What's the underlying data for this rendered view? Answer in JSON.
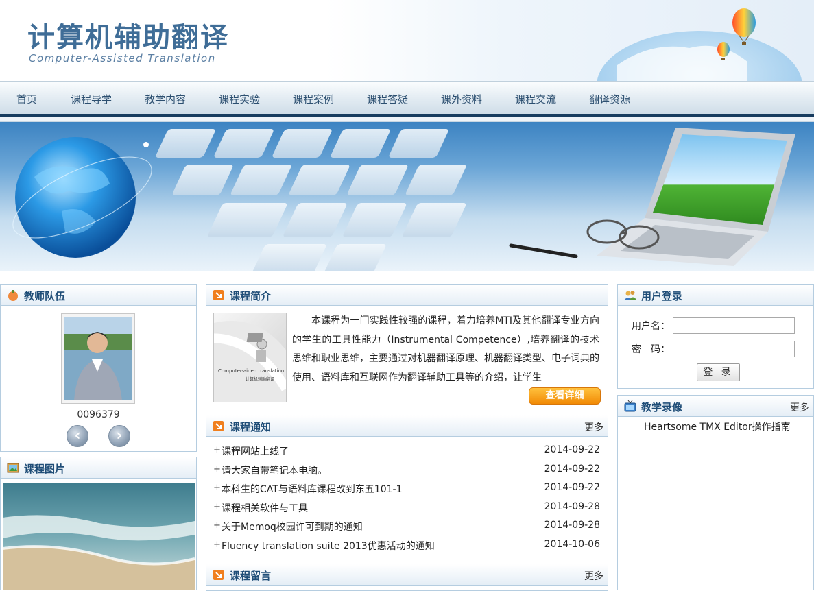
{
  "header": {
    "title": "计算机辅助翻译",
    "subtitle": "Computer-Assisted Translation"
  },
  "nav": {
    "items": [
      {
        "label": "首页"
      },
      {
        "label": "课程导学"
      },
      {
        "label": "教学内容"
      },
      {
        "label": "课程实验"
      },
      {
        "label": "课程案例"
      },
      {
        "label": "课程答疑"
      },
      {
        "label": "课外资料"
      },
      {
        "label": "课程交流"
      },
      {
        "label": "翻译资源"
      }
    ]
  },
  "teachers": {
    "title": "教师队伍",
    "count": "0096379"
  },
  "course_photos": {
    "title": "课程图片"
  },
  "intro": {
    "title": "课程简介",
    "image_caption_en": "Computer-aided translation",
    "image_caption_cn": "计算机辅助翻译",
    "text": "本课程为一门实践性较强的课程，着力培养MTI及其他翻译专业方向的学生的工具性能力（Instrumental Competence）,培养翻译的技术思维和职业思维，主要通过对机器翻译原理、机器翻译类型、电子词典的使用、语料库和互联网作为翻译辅助工具等的介绍，让学生",
    "detail_label": "查看详细"
  },
  "notices": {
    "title": "课程通知",
    "more": "更多",
    "items": [
      {
        "title": "课程网站上线了",
        "date": "2014-09-22"
      },
      {
        "title": "请大家自带笔记本电脑。",
        "date": "2014-09-22"
      },
      {
        "title": "本科生的CAT与语料库课程改到东五101-1",
        "date": "2014-09-22"
      },
      {
        "title": "课程相关软件与工具",
        "date": "2014-09-28"
      },
      {
        "title": "关于Memoq校园许可到期的通知",
        "date": "2014-09-28"
      },
      {
        "title": "Fluency translation suite 2013优惠活动的通知",
        "date": "2014-10-06"
      }
    ]
  },
  "messages": {
    "title": "课程留言",
    "more": "更多"
  },
  "login": {
    "title": "用户登录",
    "username_label": "用户名：",
    "password_label": "密　码：",
    "username_value": "",
    "password_value": "",
    "button_label": "登 录"
  },
  "videos": {
    "title": "教学录像",
    "more": "更多",
    "items": [
      {
        "title": "Heartsome TMX Editor操作指南"
      }
    ]
  },
  "colors": {
    "accent": "#1f4d77",
    "nav_bar": "#173c5f",
    "button_orange": "#f18a05",
    "panel_border": "#b5cde0"
  }
}
